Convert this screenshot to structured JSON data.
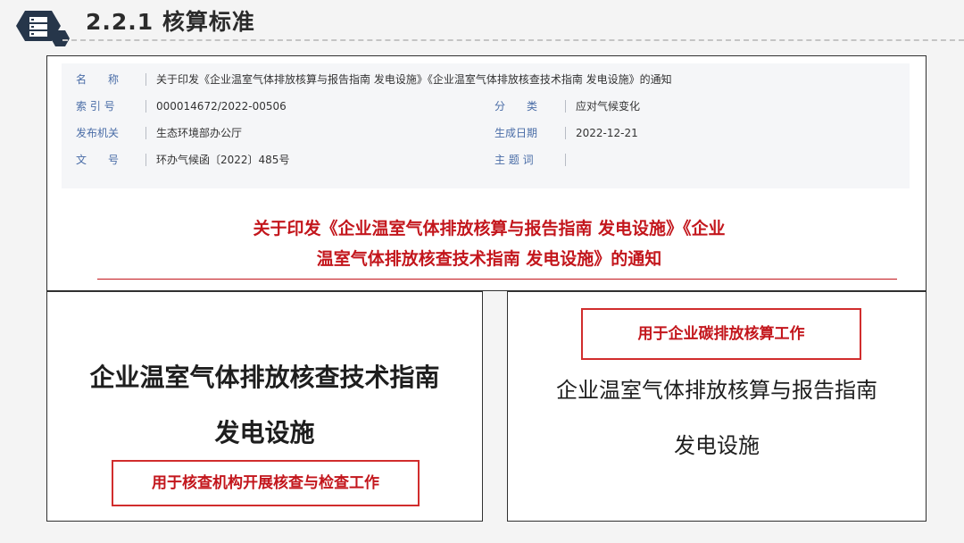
{
  "header": {
    "icon": "server-stack-icon",
    "title": "2.2.1 核算标准"
  },
  "metadata": {
    "rows": [
      {
        "label": "名　　称",
        "value": "关于印发《企业温室气体排放核算与报告指南 发电设施》《企业温室气体排放核查技术指南 发电设施》的通知"
      },
      {
        "label": "索 引 号",
        "value": "000014672/2022-00506",
        "label2": "分　　类",
        "value2": "应对气候变化"
      },
      {
        "label": "发布机关",
        "value": "生态环境部办公厅",
        "label2": "生成日期",
        "value2": "2022-12-21"
      },
      {
        "label": "文　　号",
        "value": "环办气候函〔2022〕485号",
        "label2": "主 题 词",
        "value2": ""
      }
    ]
  },
  "notice": {
    "line1": "关于印发《企业温室气体排放核算与报告指南 发电设施》《企业",
    "line2": "温室气体排放核查技术指南 发电设施》的通知",
    "color": "#c3161c"
  },
  "left_doc": {
    "title_line1": "企业温室气体排放核查技术指南",
    "title_line2": "发电设施",
    "tag": "用于核查机构开展核查与检查工作"
  },
  "right_doc": {
    "tag": "用于企业碳排放核算工作",
    "title_line1": "企业温室气体排放核算与报告指南",
    "title_line2": "发电设施"
  }
}
